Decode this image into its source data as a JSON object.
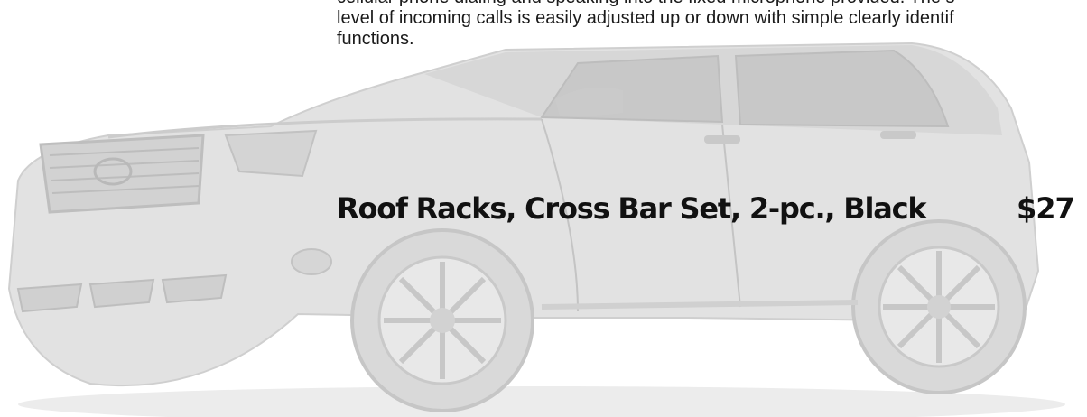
{
  "description": {
    "lines": [
      "cellular phone dialing and speaking into the fixed microphone provided. The s",
      "level of incoming calls is easily adjusted up or down with simple clearly identif",
      "functions."
    ]
  },
  "product": {
    "name": "Roof Racks, Cross Bar Set, 2-pc., Black",
    "price": "$27"
  },
  "illustration": {
    "subject": "suv-watermark",
    "tone": "#c9c9c9"
  }
}
